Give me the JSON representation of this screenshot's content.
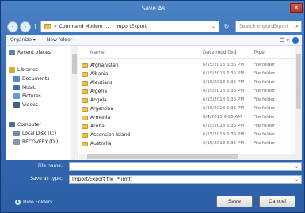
{
  "window": {
    "title": "Save As",
    "close_glyph": "✕"
  },
  "nav": {
    "back_glyph": "‹",
    "forward_glyph": "›",
    "up_glyph": "↑",
    "breadcrumb": [
      "«",
      "Command Modem ...",
      "›",
      "ImportExport"
    ],
    "dropdown_glyph": "⌄",
    "refresh_glyph": "↻",
    "search_placeholder": "Search ImportExport",
    "search_icon_glyph": "⌕"
  },
  "toolbar": {
    "organize_label": "Organize ▾",
    "new_folder_label": "New folder",
    "views_glyph": "☰ ▾"
  },
  "sidebar": {
    "items": [
      {
        "label": "Recent places",
        "icon": "recent-places-icon",
        "color": "#5c7fb3"
      },
      {
        "label": "Libraries",
        "icon": "libraries-icon",
        "color": "#d8a93c"
      },
      {
        "label": "Documents",
        "icon": "documents-icon",
        "color": "#5e86c7"
      },
      {
        "label": "Music",
        "icon": "music-icon",
        "color": "#3a6fb6"
      },
      {
        "label": "Pictures",
        "icon": "pictures-icon",
        "color": "#5aa0d8"
      },
      {
        "label": "Videos",
        "icon": "videos-icon",
        "color": "#3f5f8a"
      },
      {
        "label": "Computer",
        "icon": "computer-icon",
        "color": "#4f6f9a"
      },
      {
        "label": "Local Disk (C:)",
        "icon": "local-disk-icon",
        "color": "#7a8a9c"
      },
      {
        "label": "RECOVERY (D:)",
        "icon": "recovery-drive-icon",
        "color": "#8a96a6"
      }
    ]
  },
  "filelist": {
    "columns": {
      "name": "Name",
      "date": "Date modified",
      "type": "Type"
    },
    "rows": [
      {
        "name": "Afghanistan",
        "date": "6/15/2013 6:35 PM",
        "type": "File folder"
      },
      {
        "name": "Albania",
        "date": "6/15/2013 6:35 PM",
        "type": "File folder"
      },
      {
        "name": "Aleutians",
        "date": "6/15/2013 6:35 PM",
        "type": "File folder"
      },
      {
        "name": "Algeria",
        "date": "6/15/2013 6:35 PM",
        "type": "File folder"
      },
      {
        "name": "Angola",
        "date": "6/15/2013 6:35 PM",
        "type": "File folder"
      },
      {
        "name": "Argentina",
        "date": "6/15/2013 6:35 PM",
        "type": "File folder"
      },
      {
        "name": "Armenia",
        "date": "8/4/2013 9:25 AM",
        "type": "File folder"
      },
      {
        "name": "Aruba",
        "date": "6/15/2013 6:35 PM",
        "type": "File folder"
      },
      {
        "name": "Ascension Island",
        "date": "6/15/2013 6:35 PM",
        "type": "File folder"
      },
      {
        "name": "Australia",
        "date": "6/15/2013 6:35 PM",
        "type": "File folder"
      }
    ]
  },
  "form": {
    "filename_label": "File name:",
    "filename_value": "",
    "savetype_label": "Save as type:",
    "savetype_value": "Import/Export file (*.imtf)"
  },
  "footer": {
    "hide_folders_label": "Hide Folders",
    "hide_folders_glyph": "▲",
    "save_label": "Save",
    "cancel_label": "Cancel"
  },
  "colors": {
    "chrome_blue": "#3a70b6",
    "folder_yellow": "#e7c255"
  }
}
